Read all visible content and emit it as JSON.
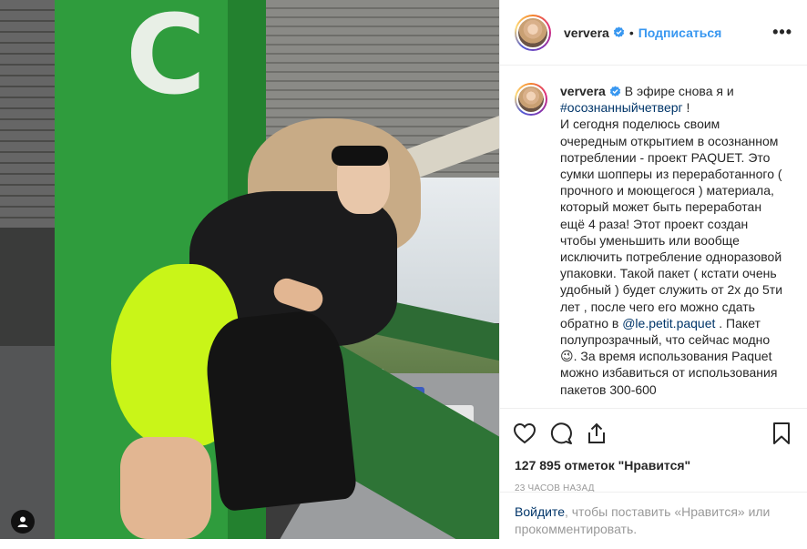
{
  "header": {
    "username": "ververa",
    "follow_label": "Подписаться",
    "dot": "•",
    "more_label": "•••"
  },
  "caption": {
    "username": "ververa",
    "text_1": " В эфире снова я и ",
    "hashtag": "#осознанныйчетверг",
    "text_2": " !\nИ сегодня поделюсь своим очередным открытием в осознанном потреблении - проект PAQUET. Это сумки шопперы из переработанного ( прочного и моющегося ) материала, который может быть переработан ещё 4 раза! Этот проект создан чтобы уменьшить или вообще исключить потребление одноразовой упаковки. Такой пакет ( кстати очень удобный ) будет служить от 2х до 5ти лет , после чего его можно сдать обратно в ",
    "mention": "@le.petit.paquet",
    "text_3": " . Пакет полупрозрачный, что сейчас модно ",
    "emoji": "😉",
    "text_4": ". За время использования Paquet можно избавиться от использования пакетов 300-600"
  },
  "photo": {
    "pillar_letter": "C"
  },
  "actions": {
    "likes": "127 895 отметок \"Нравится\"",
    "time": "23 часов назад"
  },
  "login_prompt": {
    "login_link": "Войдите",
    "rest": ", чтобы поставить «Нравится» или прокомментировать."
  },
  "colors": {
    "accent": "#3897f0",
    "link": "#003569",
    "pillar_green": "#2f9c3d",
    "shorts_neon": "#c9f518"
  }
}
